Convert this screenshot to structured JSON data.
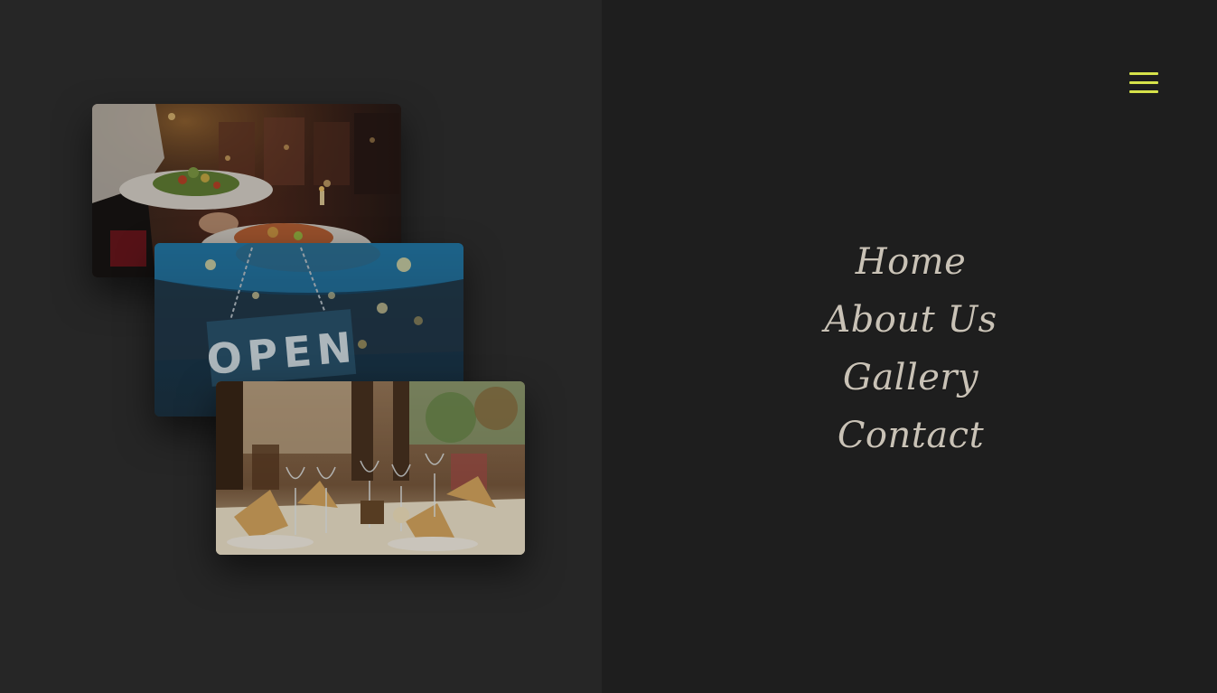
{
  "menu": {
    "icon": "hamburger-menu-icon",
    "accent_color": "#d6e24a"
  },
  "nav": {
    "items": [
      {
        "label": "Home"
      },
      {
        "label": "About Us"
      },
      {
        "label": "Gallery"
      },
      {
        "label": "Contact"
      }
    ],
    "text_color": "#c9c2b6"
  },
  "gallery": {
    "photos": [
      {
        "subject": "waiter-serving-salad-photo"
      },
      {
        "subject": "open-sign-photo",
        "sign_text": "OPEN"
      },
      {
        "subject": "restaurant-table-setting-photo"
      }
    ]
  }
}
